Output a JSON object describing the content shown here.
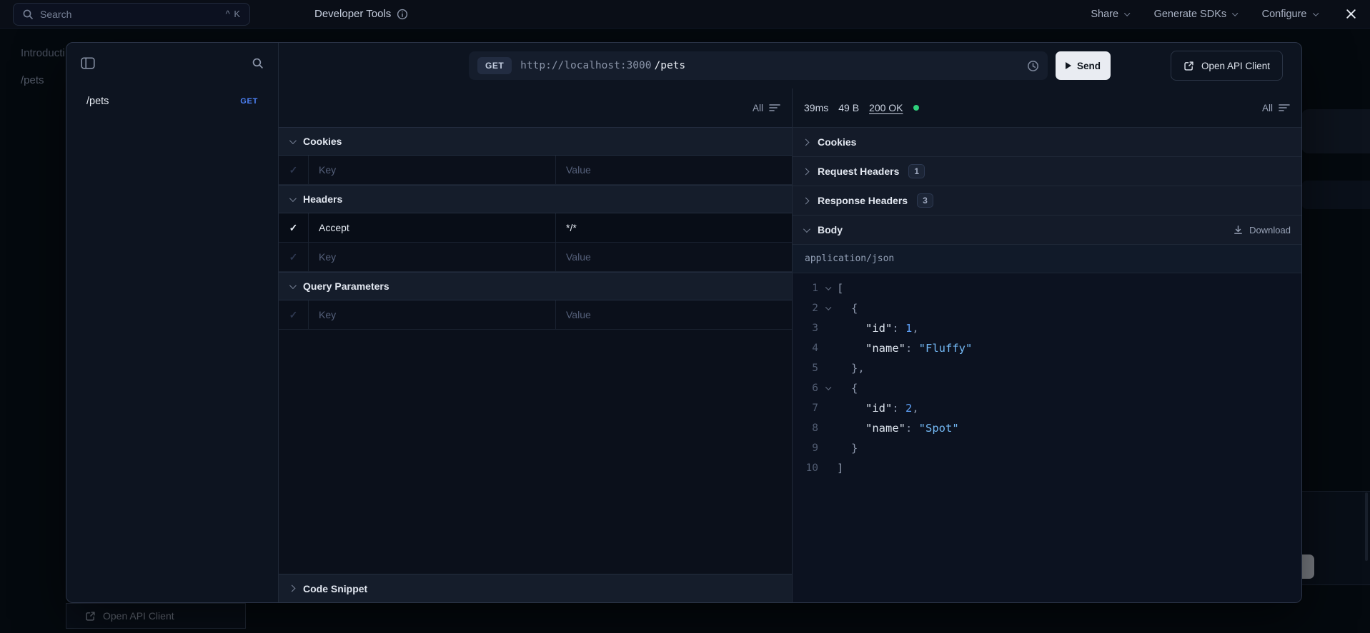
{
  "colors": {
    "accent": "#4d82f7",
    "success": "#2fd07c"
  },
  "topbar": {
    "search": {
      "placeholder": "Search",
      "shortcut": "^ K"
    },
    "title": "Developer Tools",
    "menus": [
      {
        "label": "Share"
      },
      {
        "label": "Generate SDKs"
      },
      {
        "label": "Configure"
      }
    ]
  },
  "background": {
    "nav_items": [
      {
        "label": "Introduction"
      },
      {
        "label": "/pets"
      }
    ],
    "open_api_client": "Open API Client"
  },
  "modal": {
    "sidebar": {
      "requests": [
        {
          "path": "/pets",
          "method": "GET"
        }
      ]
    },
    "request_bar": {
      "method": "GET",
      "base_url": "http://localhost:3000",
      "path": "/pets",
      "send_label": "Send",
      "open_api_client_label": "Open API Client"
    },
    "request_panel": {
      "filter_label": "All",
      "sections": [
        {
          "title": "Cookies",
          "expanded": true,
          "rows": [
            {
              "checked": false,
              "key": "",
              "value": "",
              "key_placeholder": "Key",
              "value_placeholder": "Value"
            }
          ]
        },
        {
          "title": "Headers",
          "expanded": true,
          "rows": [
            {
              "checked": true,
              "key": "Accept",
              "value": "*/*",
              "key_placeholder": "Key",
              "value_placeholder": "Value"
            },
            {
              "checked": false,
              "key": "",
              "value": "",
              "key_placeholder": "Key",
              "value_placeholder": "Value"
            }
          ]
        },
        {
          "title": "Query Parameters",
          "expanded": true,
          "rows": [
            {
              "checked": false,
              "key": "",
              "value": "",
              "key_placeholder": "Key",
              "value_placeholder": "Value"
            }
          ]
        }
      ],
      "code_snippet_label": "Code Snippet"
    },
    "response_panel": {
      "filter_label": "All",
      "meta": {
        "duration": "39ms",
        "size": "49 B",
        "status": "200 OK"
      },
      "sections": [
        {
          "title": "Cookies",
          "expanded": false
        },
        {
          "title": "Request Headers",
          "badge": "1",
          "expanded": false
        },
        {
          "title": "Response Headers",
          "badge": "3",
          "expanded": false
        },
        {
          "title": "Body",
          "expanded": true,
          "action": "Download"
        }
      ],
      "content_type": "application/json",
      "body": [
        {
          "id": 1,
          "name": "Fluffy"
        },
        {
          "id": 2,
          "name": "Spot"
        }
      ],
      "code_lines": [
        {
          "num": 1,
          "fold": true,
          "indent": 0,
          "tokens": [
            {
              "t": "[",
              "c": "punc"
            }
          ]
        },
        {
          "num": 2,
          "fold": true,
          "indent": 1,
          "tokens": [
            {
              "t": "{",
              "c": "punc"
            }
          ]
        },
        {
          "num": 3,
          "indent": 2,
          "tokens": [
            {
              "t": "\"id\"",
              "c": "key"
            },
            {
              "t": ": ",
              "c": "punc"
            },
            {
              "t": "1",
              "c": "num"
            },
            {
              "t": ",",
              "c": "punc"
            }
          ]
        },
        {
          "num": 4,
          "indent": 2,
          "tokens": [
            {
              "t": "\"name\"",
              "c": "key"
            },
            {
              "t": ": ",
              "c": "punc"
            },
            {
              "t": "\"Fluffy\"",
              "c": "str"
            }
          ]
        },
        {
          "num": 5,
          "indent": 1,
          "tokens": [
            {
              "t": "},",
              "c": "punc"
            }
          ]
        },
        {
          "num": 6,
          "fold": true,
          "indent": 1,
          "tokens": [
            {
              "t": "{",
              "c": "punc"
            }
          ]
        },
        {
          "num": 7,
          "indent": 2,
          "tokens": [
            {
              "t": "\"id\"",
              "c": "key"
            },
            {
              "t": ": ",
              "c": "punc"
            },
            {
              "t": "2",
              "c": "num"
            },
            {
              "t": ",",
              "c": "punc"
            }
          ]
        },
        {
          "num": 8,
          "indent": 2,
          "tokens": [
            {
              "t": "\"name\"",
              "c": "key"
            },
            {
              "t": ": ",
              "c": "punc"
            },
            {
              "t": "\"Spot\"",
              "c": "str"
            }
          ]
        },
        {
          "num": 9,
          "indent": 1,
          "tokens": [
            {
              "t": "}",
              "c": "punc"
            }
          ]
        },
        {
          "num": 10,
          "indent": 0,
          "tokens": [
            {
              "t": "]",
              "c": "punc"
            }
          ]
        }
      ]
    }
  }
}
